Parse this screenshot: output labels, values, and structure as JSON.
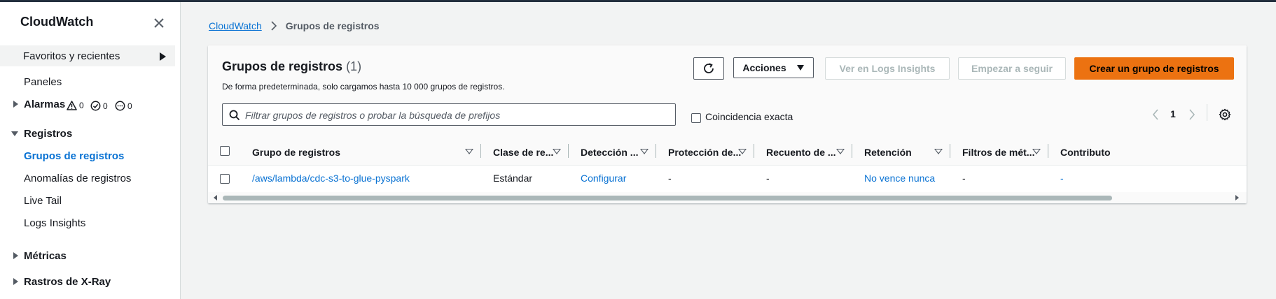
{
  "sidebar": {
    "title": "CloudWatch",
    "favorites_label": "Favoritos y recientes",
    "items": {
      "dashboards": "Paneles",
      "alarms": "Alarmas",
      "alarm_in_alarm": "0",
      "alarm_ok": "0",
      "alarm_insufficient": "0",
      "logs": "Registros",
      "log_groups": "Grupos de registros",
      "log_anomalies": "Anomalías de registros",
      "live_tail": "Live Tail",
      "logs_insights": "Logs Insights",
      "metrics": "Métricas",
      "xray": "Rastros de X-Ray"
    }
  },
  "breadcrumb": {
    "root": "CloudWatch",
    "current": "Grupos de registros"
  },
  "panel": {
    "title": "Grupos de registros",
    "count": "(1)",
    "description": "De forma predeterminada, solo cargamos hasta 10 000 grupos de registros.",
    "actions_label": "Acciones",
    "view_insights_label": "Ver en Logs Insights",
    "follow_label": "Empezar a seguir",
    "create_label": "Crear un grupo de registros",
    "search_placeholder": "Filtrar grupos de registros o probar la búsqueda de prefijos",
    "exact_match_label": "Coincidencia exacta",
    "page_number": "1"
  },
  "table": {
    "columns": {
      "group": "Grupo de registros",
      "class": "Clase de re...",
      "detection": "Detección ...",
      "protection": "Protección de...",
      "count": "Recuento de ...",
      "retention": "Retención",
      "filters": "Filtros de mét...",
      "contributor": "Contributo"
    },
    "rows": [
      {
        "group": "/aws/lambda/cdc-s3-to-glue-pyspark",
        "class": "Estándar",
        "detection": "Configurar",
        "protection": "-",
        "count": "-",
        "retention": "No vence nunca",
        "filters": "-",
        "contributor": "-"
      }
    ]
  },
  "colors": {
    "accent": "#0972d3",
    "primary_button": "#ec7211",
    "sidebar_bg": "#ffffff",
    "page_bg": "#f2f3f3",
    "top_bar": "#232f3e"
  }
}
